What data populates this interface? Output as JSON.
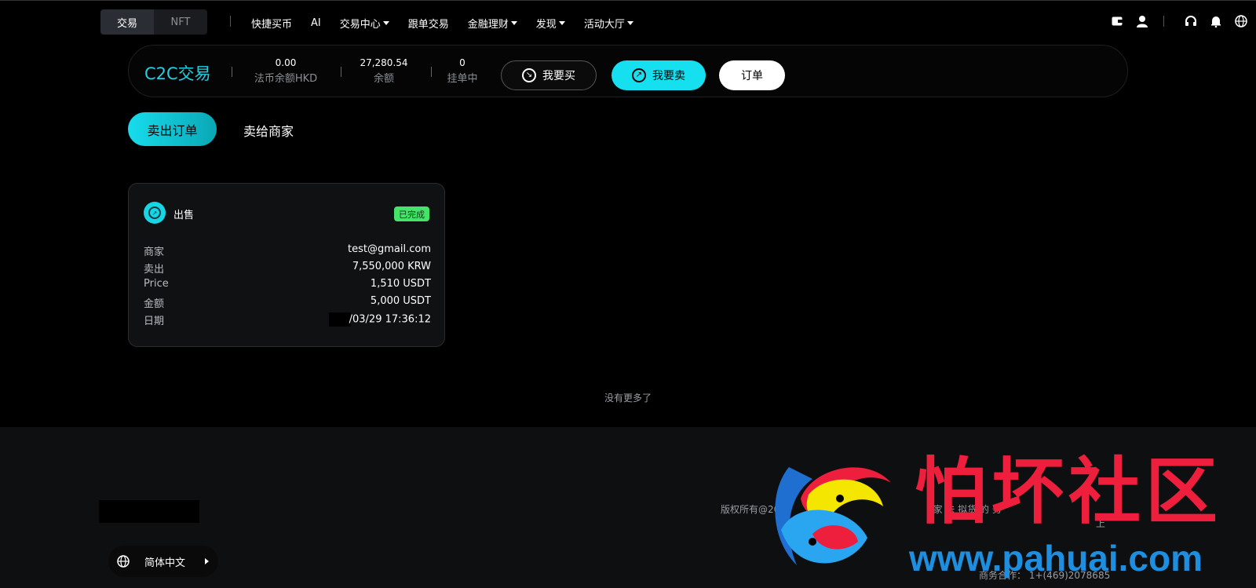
{
  "nav": {
    "mode_tabs": [
      "交易",
      "NFT"
    ],
    "items": [
      {
        "label": "快捷买币",
        "dropdown": false
      },
      {
        "label": "AI",
        "dropdown": false
      },
      {
        "label": "交易中心",
        "dropdown": true
      },
      {
        "label": "跟单交易",
        "dropdown": false
      },
      {
        "label": "金融理财",
        "dropdown": true
      },
      {
        "label": "发现",
        "dropdown": true
      },
      {
        "label": "活动大厅",
        "dropdown": true
      }
    ],
    "right_icons": [
      "wallet-icon",
      "user-icon",
      "headset-icon",
      "bell-icon",
      "globe-icon"
    ]
  },
  "c2c": {
    "title": "C2C交易",
    "fiat_balance_value": "0.00",
    "fiat_balance_label": "法币余额HKD",
    "balance_value": "27,280.54",
    "balance_label": "余额",
    "pending_value": "0",
    "pending_label": "挂单中",
    "buy_label": "我要买",
    "sell_label": "我要卖",
    "order_label": "订单"
  },
  "tabs": {
    "active": "卖出订单",
    "other": "卖给商家"
  },
  "order": {
    "type": "出售",
    "status": "已完成",
    "rows": [
      {
        "key": "商家",
        "value": "test@gmail.com"
      },
      {
        "key": "卖出",
        "value": "7,550,000 KRW"
      },
      {
        "key": "Price",
        "value": "1,510 USDT"
      },
      {
        "key": "金额",
        "value": "5,000 USDT"
      },
      {
        "key": "日期",
        "value": "/03/29 17:36:12"
      }
    ]
  },
  "no_more": "没有更多了",
  "footer": {
    "copyright": "版权所有@202",
    "copyright_tail": "家 法 拟货 的 务",
    "copyright_line2": "上",
    "contact": "商务合作： 1+(469)2078685",
    "language": "简体中文"
  },
  "watermark": {
    "title": "怕坏社区",
    "url": "www.pahuai.com"
  },
  "colors": {
    "accent": "#16e0ef",
    "success": "#45e36a",
    "watermark_red": "#ee1f3d",
    "watermark_blue": "#1e8fe0"
  }
}
